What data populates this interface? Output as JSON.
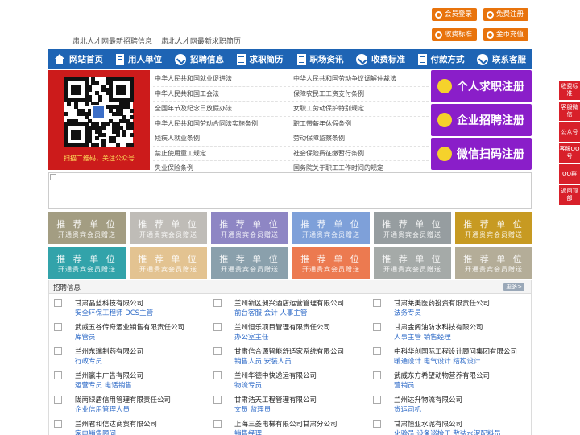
{
  "header": {
    "links": [
      "肃北人才网最新招聘信息",
      "肃北人才网最新求职简历"
    ],
    "buttons": [
      {
        "label": "会员登录",
        "icon": "user-icon"
      },
      {
        "label": "免费注册",
        "icon": "register-icon"
      },
      {
        "label": "收费标准",
        "icon": "price-icon"
      },
      {
        "label": "金币充值",
        "icon": "coin-icon"
      }
    ]
  },
  "nav": [
    {
      "label": "网站首页",
      "icon": "home-icon"
    },
    {
      "label": "用人单位",
      "icon": "building-icon"
    },
    {
      "label": "招聘信息",
      "icon": "check-icon"
    },
    {
      "label": "求职简历",
      "icon": "resume-icon"
    },
    {
      "label": "职场资讯",
      "icon": "news-icon"
    },
    {
      "label": "收费标准",
      "icon": "price-icon"
    },
    {
      "label": "付款方式",
      "icon": "payment-icon"
    },
    {
      "label": "联系客服",
      "icon": "service-icon"
    }
  ],
  "qr_caption": "扫描二维码，关注公众号",
  "links_left": [
    "中华人民共和国就业促进法",
    "中华人民共和国工会法",
    "全国年节及纪念日放假办法",
    "中华人民共和国劳动合同法实施条例",
    "残疾人就业条例",
    "禁止使用童工规定",
    "失业保险条例"
  ],
  "links_right": [
    "中华人民共和国劳动争议调解仲裁法",
    "保障农民工工资支付条例",
    "女职工劳动保护特别规定",
    "职工带薪年休假条例",
    "劳动保障监察条例",
    "社会保险费征缴暂行条例",
    "国务院关于职工工作时间的规定"
  ],
  "register": [
    {
      "label": "个人求职注册"
    },
    {
      "label": "企业招聘注册"
    },
    {
      "label": "微信扫码注册"
    }
  ],
  "tiles": {
    "title": "推 荐 单 位",
    "subtitle": "开通贵宾会员赠送",
    "colors": [
      "#a39d82",
      "#bfbcb7",
      "#8e86c4",
      "#7ea0d9",
      "#969da0",
      "#c79a22",
      "#32a3aa",
      "#e3c391",
      "#8aa0ac",
      "#ec7a50",
      "#a5aaa8",
      "#b4ad98"
    ]
  },
  "jobs": {
    "title": "招聘信息",
    "more": "更多>",
    "cols": [
      [
        {
          "company": "甘肃晶蓝科技有限公司",
          "positions": "安全环保工程师 DCS主管"
        },
        {
          "company": "武威五谷传奇酒业销售有限责任公司",
          "positions": "库管员"
        },
        {
          "company": "兰州东瑞制药有限公司",
          "positions": "行政专员"
        },
        {
          "company": "兰州赢丰广告有限公司",
          "positions": "运营专员 电话销售"
        },
        {
          "company": "陇南绿盾信用管理有限责任公司",
          "positions": "企业信用管理人员"
        },
        {
          "company": "兰州君和信达商贸有限公司",
          "positions": "家电销售顾问"
        }
      ],
      [
        {
          "company": "兰州新区昶兴酒店运营管理有限公司",
          "positions": "前台客服 会计 人事主管"
        },
        {
          "company": "兰州恒乐项目管理有限责任公司",
          "positions": "办公室主任"
        },
        {
          "company": "甘肃信合源智能舒适家系统有限公司",
          "positions": "销售人员 安装人员"
        },
        {
          "company": "兰州华德中快递运有限公司",
          "positions": "物流专员"
        },
        {
          "company": "甘肃浩天工程管理有限公司",
          "positions": "文员 监理员"
        },
        {
          "company": "上海三菱电梯有限公司甘肃分公司",
          "positions": "销售经理"
        }
      ],
      [
        {
          "company": "甘肃莱美医药投资有限责任公司",
          "positions": "法务专员"
        },
        {
          "company": "甘肃金阁油防水科技有限公司",
          "positions": "人事主管 销售经理"
        },
        {
          "company": "中科华创国际工程设计顾问集团有限公司",
          "positions": "暖通设计 电气设计 结构设计"
        },
        {
          "company": "武威东方希望动物营养有限公司",
          "positions": "营销员"
        },
        {
          "company": "兰州达升物流有限公司",
          "positions": "货运司机"
        },
        {
          "company": "甘肃恒亚水泥有限公司",
          "positions": "化验员 设备巡检工 散装水泥配料员"
        }
      ]
    ]
  },
  "sidebar": [
    "收费标准",
    "客服微信",
    "公众号",
    "客服QQ号",
    "QQ群",
    "返回顶部"
  ]
}
